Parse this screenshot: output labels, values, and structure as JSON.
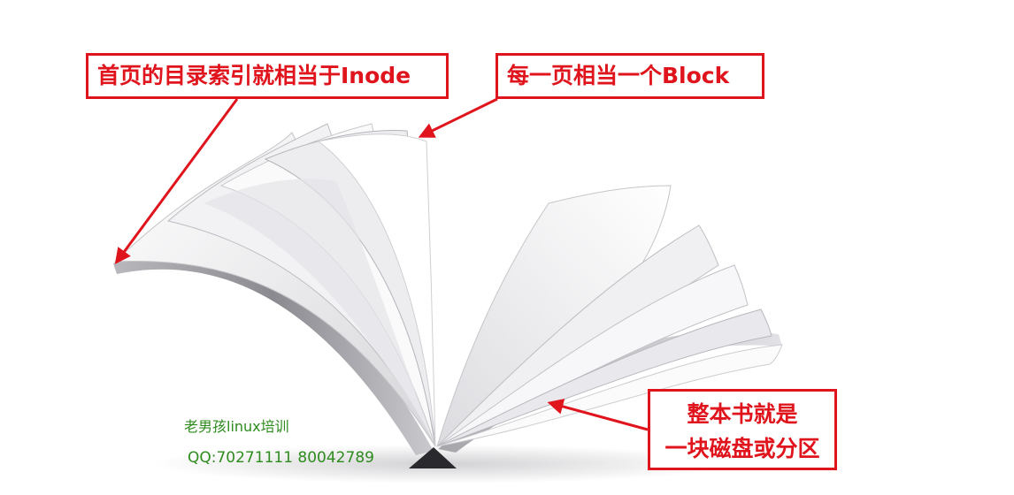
{
  "labels": {
    "inode": "首页的目录索引就相当于Inode",
    "block": "每一页相当一个Block",
    "disk_line1": "整本书就是",
    "disk_line2": "一块磁盘或分区"
  },
  "watermark": {
    "school": "老男孩linux培训",
    "qq": "QQ:70271111 80042789"
  },
  "colors": {
    "annotation": "#e0141c",
    "watermark": "#2e8b1e",
    "page": "#f4f4f6",
    "page_shadow": "#9a9aa0"
  },
  "icons": {
    "illustration": "open-book-icon"
  }
}
